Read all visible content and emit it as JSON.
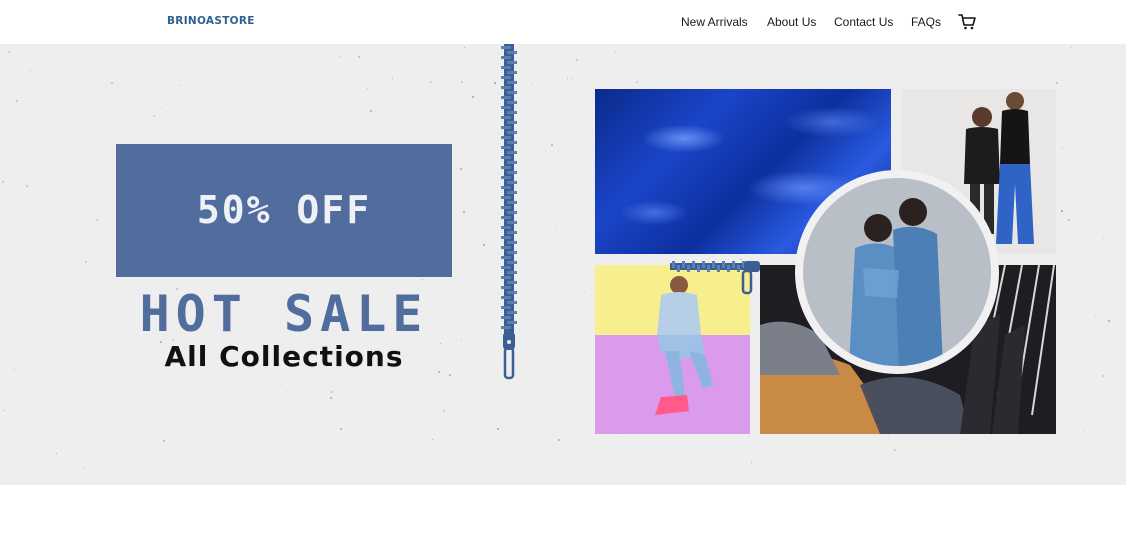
{
  "brand": {
    "logo_text": "BRINOASTORE"
  },
  "nav": {
    "items": [
      {
        "label": "New Arrivals"
      },
      {
        "label": "About Us"
      },
      {
        "label": "Contact Us"
      },
      {
        "label": "FAQs"
      }
    ],
    "cart_icon": "shopping-cart-icon"
  },
  "hero": {
    "offer": "50% OFF",
    "headline": "HOT SALE",
    "subheadline": "All Collections",
    "colors": {
      "accent": "#506d9e",
      "background": "#eeeeee",
      "logo": "#2f5f8f"
    },
    "images": [
      {
        "name": "blue-velvet-fabric-image"
      },
      {
        "name": "two-models-standing-image"
      },
      {
        "name": "denim-couple-circle-image"
      },
      {
        "name": "pastel-model-sitting-image"
      },
      {
        "name": "clothes-rack-sweaters-image"
      }
    ],
    "decorations": [
      "vertical-zipper-icon",
      "horizontal-zipper-icon"
    ]
  }
}
